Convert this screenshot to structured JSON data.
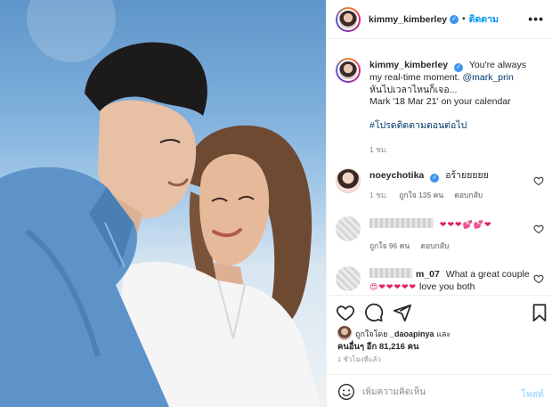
{
  "header": {
    "username": "kimmy_kimberley",
    "separator": "•",
    "follow_label": "ติดตาม"
  },
  "caption": {
    "username": "kimmy_kimberley",
    "text_before_mention": "You're always my real-time moment.",
    "mention": "@mark_prin",
    "thai_line": "หันไปเวลาไหนก็เจอ...",
    "calendar_line": "Mark '18 Mar 21' on your calendar",
    "hashtag": "#โปรดติดตามตอนต่อไป",
    "time": "1 ชม."
  },
  "comments": [
    {
      "username": "noeychotika",
      "text": "อร้ายยยยย",
      "time": "1 ชม.",
      "likes": "ถูกใจ 135 คน",
      "reply_label": "ตอบกลับ"
    },
    {
      "username": "",
      "text": "❤❤❤💕💕❤",
      "time": "",
      "likes": "ถูกใจ 96 คน",
      "reply_label": "ตอบกลับ"
    },
    {
      "username": "m_07",
      "text": "What a great couple",
      "text2_emoji": "😍❤❤❤❤❤",
      "text2": "love you both"
    }
  ],
  "likes": {
    "liked_by_prefix": "ถูกใจโดย",
    "liked_by_user": "_daoapinya",
    "liked_by_suffix": "และ",
    "others": "คนอื่นๆ อีก 81,216 คน"
  },
  "time_ago": "1 ชั่วโมงที่แล้ว",
  "add_comment": {
    "placeholder": "เพิ่มความคิดเห็น",
    "post_label": "โพสต์"
  },
  "icons": {
    "like": "heart-icon",
    "comment": "comment-icon",
    "share": "share-icon",
    "save": "bookmark-icon",
    "emoji": "smiley-icon",
    "more": "more-icon"
  },
  "colors": {
    "link_blue": "#0095f6",
    "verified_blue": "#3897f0",
    "muted": "#8e8e8e",
    "post_disabled": "#b2dffc"
  }
}
